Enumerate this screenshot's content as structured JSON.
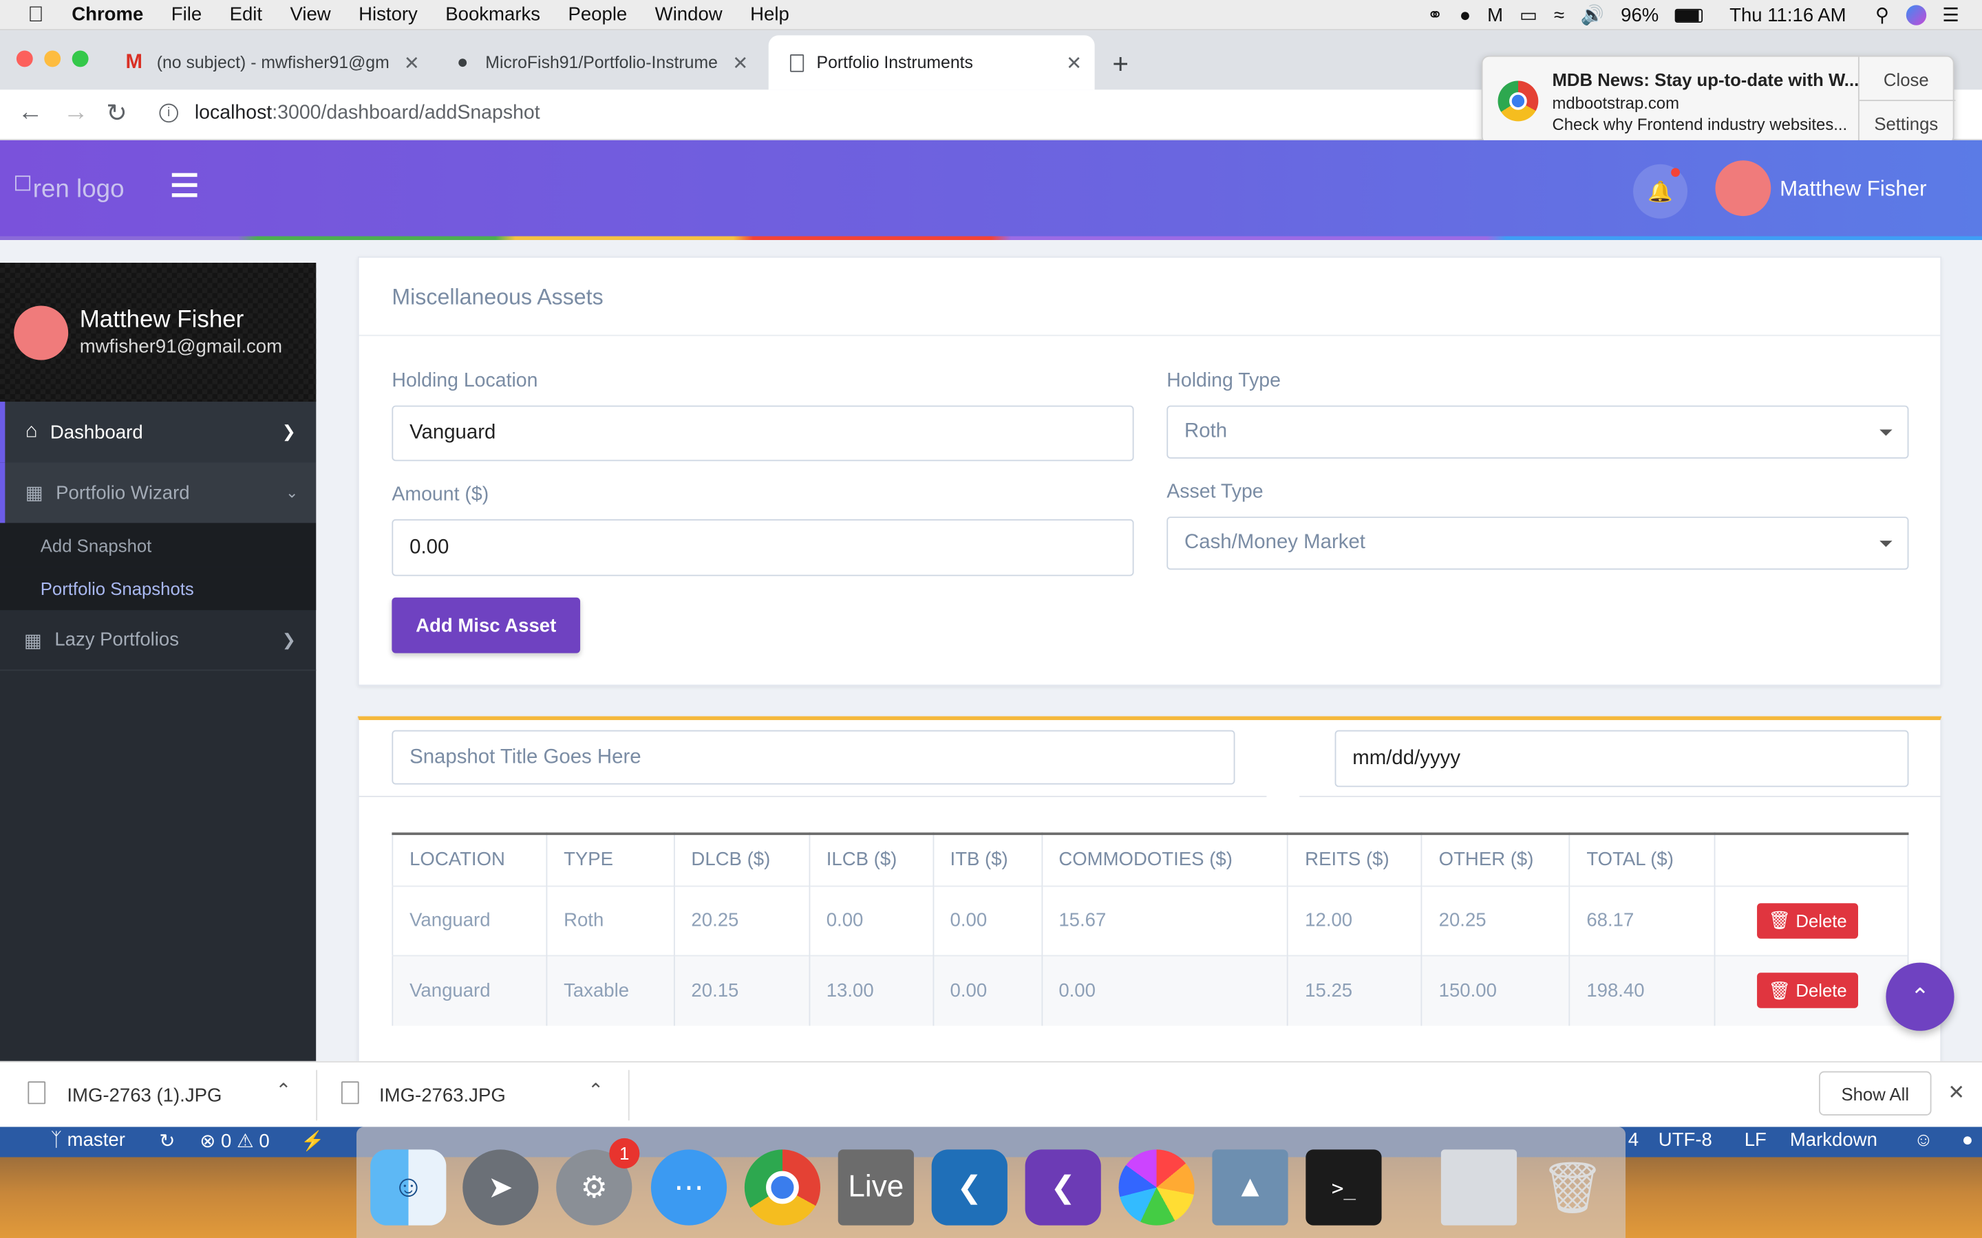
{
  "menubar": {
    "app": "Chrome",
    "items": [
      "File",
      "Edit",
      "View",
      "History",
      "Bookmarks",
      "People",
      "Window",
      "Help"
    ],
    "battery": "96%",
    "clock": "Thu 11:16 AM"
  },
  "tabs": [
    {
      "label": "(no subject) - mwfisher91@gm",
      "icon": "gmail-icon"
    },
    {
      "label": "MicroFish91/Portfolio-Instrume",
      "icon": "github-icon"
    },
    {
      "label": "Portfolio Instruments",
      "icon": "page-icon"
    }
  ],
  "address": {
    "host": "localhost",
    "path": ":3000/dashboard/addSnapshot"
  },
  "notification": {
    "title": "MDB News: Stay up-to-date with W...",
    "site": "mdbootstrap.com",
    "body": "Check why Frontend industry websites...",
    "close": "Close",
    "settings": "Settings"
  },
  "header": {
    "logo_alt": "ren logo",
    "user_name": "Matthew Fisher"
  },
  "sidebar": {
    "name": "Matthew Fisher",
    "email": "mwfisher91@gmail.com",
    "items": [
      {
        "label": "Dashboard"
      },
      {
        "label": "Portfolio Wizard"
      },
      {
        "label": "Add Snapshot"
      },
      {
        "label": "Portfolio Snapshots"
      },
      {
        "label": "Lazy Portfolios"
      }
    ]
  },
  "misc": {
    "title": "Miscellaneous Assets",
    "holding_location_label": "Holding Location",
    "holding_location_value": "Vanguard",
    "holding_type_label": "Holding Type",
    "holding_type_value": "Roth",
    "amount_label": "Amount ($)",
    "amount_value": "0.00",
    "asset_type_label": "Asset Type",
    "asset_type_value": "Cash/Money Market",
    "add_button": "Add Misc Asset"
  },
  "snapshot": {
    "title_placeholder": "Snapshot Title Goes Here",
    "date_value": "mm/dd/yyyy",
    "columns": [
      "LOCATION",
      "TYPE",
      "DLCB ($)",
      "ILCB ($)",
      "ITB ($)",
      "COMMODOTIES ($)",
      "REITS ($)",
      "OTHER ($)",
      "TOTAL ($)",
      ""
    ],
    "rows": [
      [
        "Vanguard",
        "Roth",
        "20.25",
        "0.00",
        "0.00",
        "15.67",
        "12.00",
        "20.25",
        "68.17"
      ],
      [
        "Vanguard",
        "Taxable",
        "20.15",
        "13.00",
        "0.00",
        "0.00",
        "15.25",
        "150.00",
        "198.40"
      ]
    ],
    "delete_label": "Delete"
  },
  "downloads": {
    "files": [
      "IMG-2763 (1).JPG",
      "IMG-2763.JPG"
    ],
    "show_all": "Show All"
  },
  "editor_status": {
    "branch": "master",
    "errors": "0",
    "warnings": "0",
    "encoding": "UTF-8",
    "eol": "LF",
    "language": "Markdown",
    "col": "4"
  },
  "dock": {
    "badge": "1",
    "live_label": "Live"
  },
  "colors": {
    "accent": "#6f42c1",
    "danger": "#e0353f",
    "sidebar": "#272c33",
    "header_start": "#7a52db",
    "header_end": "#5b7be6"
  }
}
